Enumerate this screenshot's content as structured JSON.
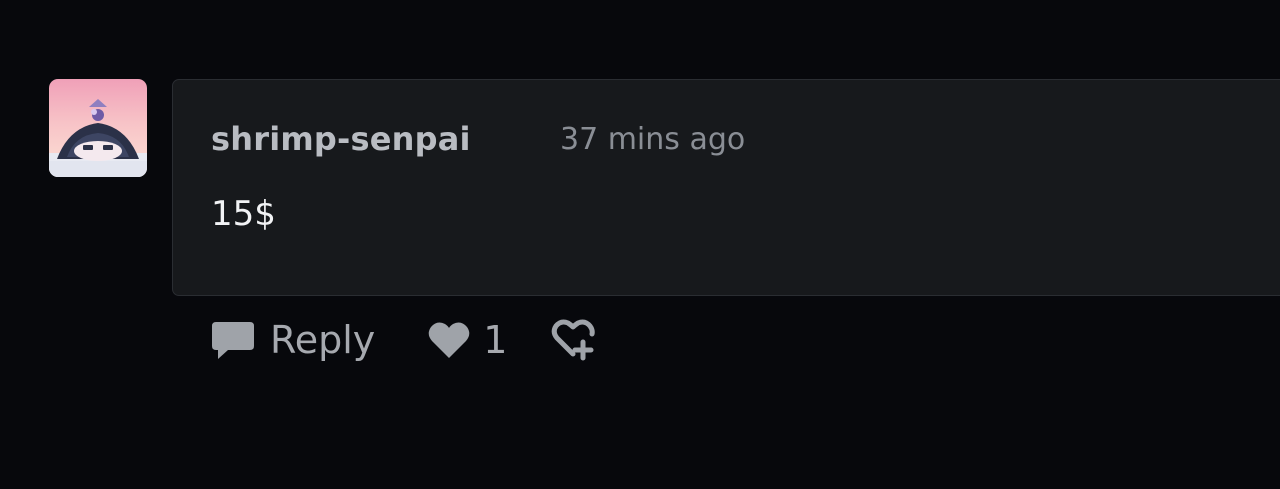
{
  "comment": {
    "author": "shrimp-senpai",
    "timestamp": "37 mins ago",
    "body": "15$"
  },
  "actions": {
    "reply_label": "Reply",
    "like_count": "1"
  },
  "icons": {
    "reply": "speech-bubble-icon",
    "like": "heart-icon",
    "add_reaction": "heart-plus-icon"
  },
  "colors": {
    "background": "#07080c",
    "card_background": "#17191c",
    "card_border": "#2a2d32",
    "author": "#b9bcc2",
    "timestamp": "#8a8e95",
    "body_text": "#f2f3f5",
    "action_icons": "#9fa3a9"
  }
}
